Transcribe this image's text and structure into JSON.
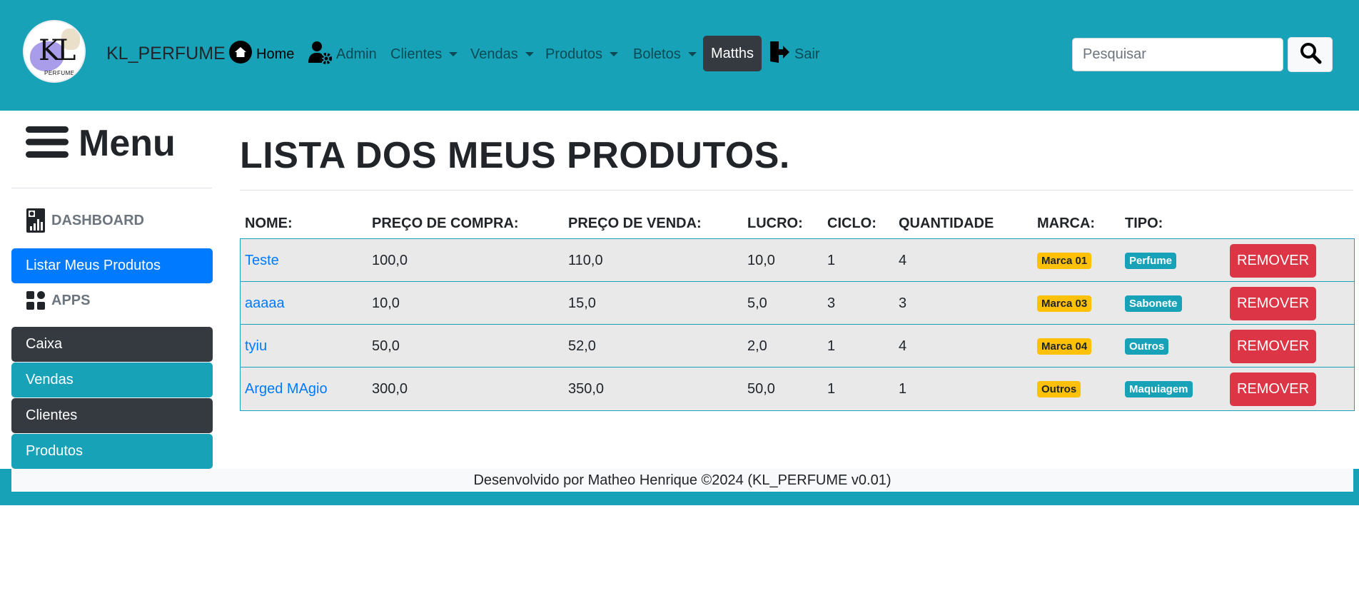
{
  "navbar": {
    "logo_text": "KL",
    "logo_subtext": "PERFUME",
    "brand": "KL_PERFUME",
    "items": [
      {
        "label": "Home"
      },
      {
        "label": "Admin"
      },
      {
        "label": "Clientes"
      },
      {
        "label": "Vendas"
      },
      {
        "label": "Produtos"
      },
      {
        "label": "Boletos"
      },
      {
        "label": "Matths"
      },
      {
        "label": "Sair"
      }
    ],
    "search_placeholder": "Pesquisar"
  },
  "sidebar": {
    "title": "Menu",
    "dashboard_label": "DASHBOARD",
    "list_products_label": "Listar Meus Produtos",
    "apps_label": "APPS",
    "buttons": [
      {
        "label": "Caixa"
      },
      {
        "label": "Vendas"
      },
      {
        "label": "Clientes"
      },
      {
        "label": "Produtos"
      }
    ]
  },
  "main": {
    "title": "LISTA DOS MEUS PRODUTOS.",
    "columns": [
      "NOME:",
      "PREÇO DE COMPRA:",
      "PREÇO DE VENDA:",
      "LUCRO:",
      "CICLO:",
      "QUANTIDADE",
      "MARCA:",
      "TIPO:"
    ],
    "remove_label": "REMOVER",
    "rows": [
      {
        "nome": "Teste",
        "compra": "100,0",
        "venda": "110,0",
        "lucro": "10,0",
        "ciclo": "1",
        "quantidade": "4",
        "marca": "Marca 01",
        "tipo": "Perfume"
      },
      {
        "nome": "aaaaa",
        "compra": "10,0",
        "venda": "15,0",
        "lucro": "5,0",
        "ciclo": "3",
        "quantidade": "3",
        "marca": "Marca 03",
        "tipo": "Sabonete"
      },
      {
        "nome": "tyiu",
        "compra": "50,0",
        "venda": "52,0",
        "lucro": "2,0",
        "ciclo": "1",
        "quantidade": "4",
        "marca": "Marca 04",
        "tipo": "Outros"
      },
      {
        "nome": "Arged MAgio",
        "compra": "300,0",
        "venda": "350,0",
        "lucro": "50,0",
        "ciclo": "1",
        "quantidade": "1",
        "marca": "Outros",
        "tipo": "Maquiagem"
      }
    ]
  },
  "footer": {
    "text": "Desenvolvido por Matheo Henrique ©2024 (KL_PERFUME v0.01)"
  },
  "colors": {
    "navbar": "#17a2b8",
    "primary": "#007bff",
    "dark": "#343a40",
    "danger": "#dc3545",
    "warning": "#ffc107"
  }
}
